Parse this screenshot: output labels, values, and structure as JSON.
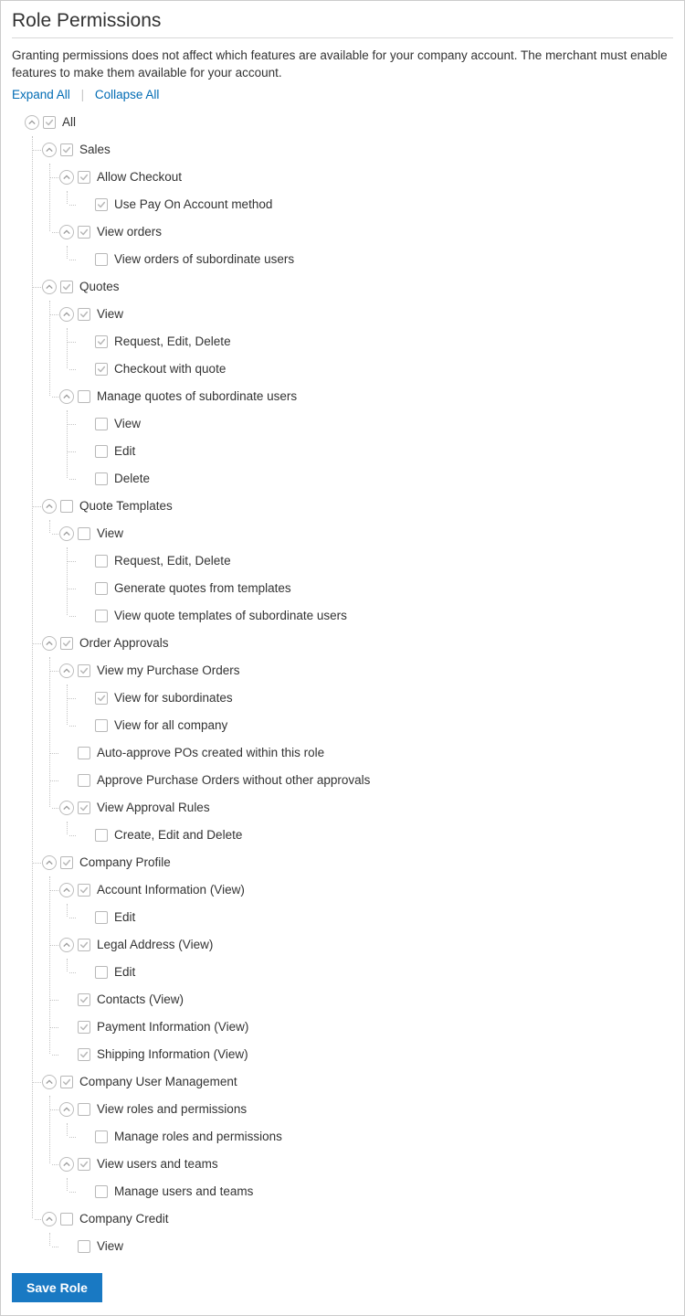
{
  "title": "Role Permissions",
  "description": "Granting permissions does not affect which features are available for your company account. The merchant must enable features to make them available for your account.",
  "tools": {
    "expand": "Expand All",
    "collapse": "Collapse All"
  },
  "save_label": "Save Role",
  "tree": [
    {
      "name": "all",
      "label": "All",
      "checked": true,
      "toggle": true,
      "children": [
        {
          "name": "sales",
          "label": "Sales",
          "checked": true,
          "toggle": true,
          "children": [
            {
              "name": "allow-checkout",
              "label": "Allow Checkout",
              "checked": true,
              "toggle": true,
              "children": [
                {
                  "name": "pay-on-account",
                  "label": "Use Pay On Account method",
                  "checked": true
                }
              ]
            },
            {
              "name": "view-orders",
              "label": "View orders",
              "checked": true,
              "toggle": true,
              "children": [
                {
                  "name": "view-orders-subordinate",
                  "label": "View orders of subordinate users",
                  "checked": false
                }
              ]
            }
          ]
        },
        {
          "name": "quotes",
          "label": "Quotes",
          "checked": true,
          "toggle": true,
          "children": [
            {
              "name": "quotes-view",
              "label": "View",
              "checked": true,
              "toggle": true,
              "children": [
                {
                  "name": "quotes-red",
                  "label": "Request, Edit, Delete",
                  "checked": true
                },
                {
                  "name": "quotes-checkout",
                  "label": "Checkout with quote",
                  "checked": true
                }
              ]
            },
            {
              "name": "quotes-sub",
              "label": "Manage quotes of subordinate users",
              "checked": false,
              "toggle": true,
              "children": [
                {
                  "name": "quotes-sub-view",
                  "label": "View",
                  "checked": false
                },
                {
                  "name": "quotes-sub-edit",
                  "label": "Edit",
                  "checked": false
                },
                {
                  "name": "quotes-sub-delete",
                  "label": "Delete",
                  "checked": false
                }
              ]
            }
          ]
        },
        {
          "name": "quote-templates",
          "label": "Quote Templates",
          "checked": false,
          "toggle": true,
          "children": [
            {
              "name": "qt-view",
              "label": "View",
              "checked": false,
              "toggle": true,
              "children": [
                {
                  "name": "qt-red",
                  "label": "Request, Edit, Delete",
                  "checked": false
                },
                {
                  "name": "qt-gen",
                  "label": "Generate quotes from templates",
                  "checked": false
                },
                {
                  "name": "qt-sub",
                  "label": "View quote templates of subordinate users",
                  "checked": false
                }
              ]
            }
          ]
        },
        {
          "name": "order-approvals",
          "label": "Order Approvals",
          "checked": true,
          "toggle": true,
          "children": [
            {
              "name": "po-view",
              "label": "View my Purchase Orders",
              "checked": true,
              "toggle": true,
              "children": [
                {
                  "name": "po-view-sub",
                  "label": "View for subordinates",
                  "checked": true
                },
                {
                  "name": "po-view-all",
                  "label": "View for all company",
                  "checked": false
                }
              ]
            },
            {
              "name": "po-auto",
              "label": "Auto-approve POs created within this role",
              "checked": false
            },
            {
              "name": "po-approve",
              "label": "Approve Purchase Orders without other approvals",
              "checked": false
            },
            {
              "name": "po-rules",
              "label": "View Approval Rules",
              "checked": true,
              "toggle": true,
              "children": [
                {
                  "name": "po-rules-ced",
                  "label": "Create, Edit and Delete",
                  "checked": false
                }
              ]
            }
          ]
        },
        {
          "name": "company-profile",
          "label": "Company Profile",
          "checked": true,
          "toggle": true,
          "children": [
            {
              "name": "cp-account",
              "label": "Account Information (View)",
              "checked": true,
              "toggle": true,
              "children": [
                {
                  "name": "cp-account-edit",
                  "label": "Edit",
                  "checked": false
                }
              ]
            },
            {
              "name": "cp-legal",
              "label": "Legal Address (View)",
              "checked": true,
              "toggle": true,
              "children": [
                {
                  "name": "cp-legal-edit",
                  "label": "Edit",
                  "checked": false
                }
              ]
            },
            {
              "name": "cp-contacts",
              "label": "Contacts (View)",
              "checked": true
            },
            {
              "name": "cp-payment",
              "label": "Payment Information (View)",
              "checked": true
            },
            {
              "name": "cp-shipping",
              "label": "Shipping Information (View)",
              "checked": true
            }
          ]
        },
        {
          "name": "company-user-mgmt",
          "label": "Company User Management",
          "checked": true,
          "toggle": true,
          "children": [
            {
              "name": "cum-roles",
              "label": "View roles and permissions",
              "checked": false,
              "toggle": true,
              "children": [
                {
                  "name": "cum-roles-manage",
                  "label": "Manage roles and permissions",
                  "checked": false
                }
              ]
            },
            {
              "name": "cum-users",
              "label": "View users and teams",
              "checked": true,
              "toggle": true,
              "children": [
                {
                  "name": "cum-users-manage",
                  "label": "Manage users and teams",
                  "checked": false
                }
              ]
            }
          ]
        },
        {
          "name": "company-credit",
          "label": "Company Credit",
          "checked": false,
          "toggle": true,
          "children": [
            {
              "name": "cc-view",
              "label": "View",
              "checked": false
            }
          ]
        }
      ]
    }
  ]
}
